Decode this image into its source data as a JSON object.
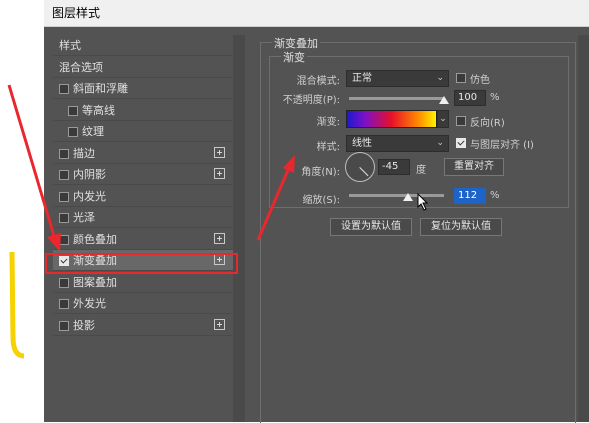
{
  "window": {
    "title": "图层样式"
  },
  "left_panel": {
    "items": [
      {
        "label": "样式",
        "checkbox": false,
        "checked": false,
        "indent": false,
        "plus": false,
        "selected": false
      },
      {
        "label": "混合选项",
        "checkbox": false,
        "checked": false,
        "indent": false,
        "plus": false,
        "selected": false
      },
      {
        "label": "斜面和浮雕",
        "checkbox": true,
        "checked": false,
        "indent": false,
        "plus": false,
        "selected": false
      },
      {
        "label": "等高线",
        "checkbox": true,
        "checked": false,
        "indent": true,
        "plus": false,
        "selected": false
      },
      {
        "label": "纹理",
        "checkbox": true,
        "checked": false,
        "indent": true,
        "plus": false,
        "selected": false
      },
      {
        "label": "描边",
        "checkbox": true,
        "checked": false,
        "indent": false,
        "plus": true,
        "selected": false
      },
      {
        "label": "内阴影",
        "checkbox": true,
        "checked": false,
        "indent": false,
        "plus": true,
        "selected": false
      },
      {
        "label": "内发光",
        "checkbox": true,
        "checked": false,
        "indent": false,
        "plus": false,
        "selected": false
      },
      {
        "label": "光泽",
        "checkbox": true,
        "checked": false,
        "indent": false,
        "plus": false,
        "selected": false
      },
      {
        "label": "颜色叠加",
        "checkbox": true,
        "checked": false,
        "indent": false,
        "plus": true,
        "selected": false
      },
      {
        "label": "渐变叠加",
        "checkbox": true,
        "checked": true,
        "indent": false,
        "plus": true,
        "selected": true
      },
      {
        "label": "图案叠加",
        "checkbox": true,
        "checked": false,
        "indent": false,
        "plus": false,
        "selected": false
      },
      {
        "label": "外发光",
        "checkbox": true,
        "checked": false,
        "indent": false,
        "plus": false,
        "selected": false
      },
      {
        "label": "投影",
        "checkbox": true,
        "checked": false,
        "indent": false,
        "plus": true,
        "selected": false
      }
    ]
  },
  "gradient_overlay": {
    "section_title": "渐变叠加",
    "subsection_title": "渐变",
    "blend_mode": {
      "label": "混合模式:",
      "value": "正常"
    },
    "dither": {
      "label": "仿色",
      "checked": false
    },
    "opacity": {
      "label": "不透明度(P):",
      "value": "100",
      "unit": "%",
      "level": 1.0
    },
    "gradient": {
      "label": "渐变:"
    },
    "reverse": {
      "label": "反向(R)",
      "checked": false
    },
    "style": {
      "label": "样式:",
      "value": "线性"
    },
    "align_with_layer": {
      "label": "与图层对齐 (I)",
      "checked": true
    },
    "angle": {
      "label": "角度(N):",
      "value": "-45",
      "unit": "度"
    },
    "reset_alignment_label": "重置对齐",
    "scale": {
      "label": "缩放(S):",
      "value": "112",
      "unit": "%",
      "level": 0.62
    },
    "make_default_label": "设置为默认值",
    "reset_default_label": "复位为默认值"
  },
  "colors": {
    "annotation_red": "#e8282e",
    "selection_blue": "#1e63c8",
    "yellow_stroke": "#f5d200"
  }
}
